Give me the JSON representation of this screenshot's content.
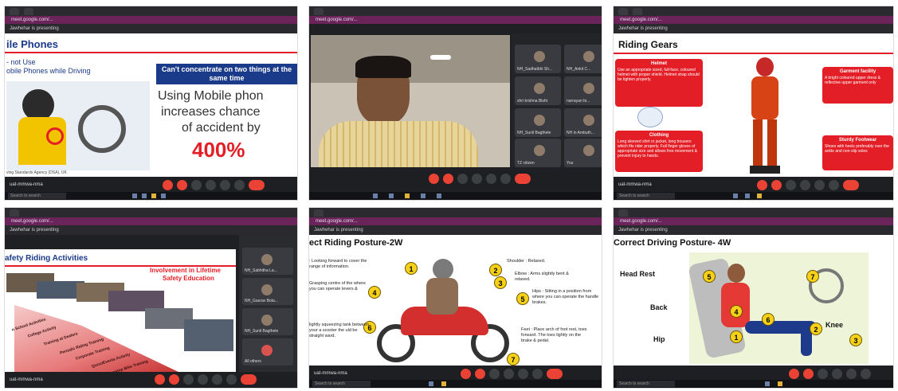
{
  "colors": {
    "meet_bar": "#6a2459",
    "accent_red": "#e31e26",
    "blue_banner": "#1a3a8a",
    "yellow_marker": "#f7d117"
  },
  "common": {
    "url": "meet.google.com/...",
    "presenting": "Jawhehar is presenting",
    "meeting_code": "uat-mmwa-nma",
    "taskbar_search": "Search to search"
  },
  "tile1": {
    "title": "ile Phones",
    "left_text_1": "- not Use",
    "left_text_2": "obile Phones while Driving",
    "banner": "Can't concentrate on two things at the same time",
    "big_1": "Using Mobile phon",
    "big_2": "increases chance",
    "big_3": "of accident by",
    "pct": "400%",
    "footer": "ving Standards Agency (DSA), UK"
  },
  "tile2": {
    "participants": [
      "NH_Sadhatbhi Sh...",
      "NH_Ankit C...",
      "shri krishna Bisht",
      "narrayan bi...",
      "NH_Sunil Bagthele",
      "NH in Ambuth...",
      "TZ citizen",
      "You"
    ]
  },
  "tile3": {
    "title": "Riding Gears",
    "helmet_title": "Helmet",
    "helmet_text": "Use an appropriate sized, full-face, coloured helmet with proper shield. Helmet strap should be tighten properly.",
    "clothing_title": "Clothing",
    "clothing_text": "Long sleeved shirt or jacket, long trousers which fits rider properly. Full finger gloves of appropriate size and allows free movement & prevent injury to hands.",
    "garment_title": "Garment facility",
    "garment_text": "A bright coloured upper dress & reflective upper garment only",
    "footwear_title": "Sturdy Footwear",
    "footwear_text": "Shoes with heels preferably over the ankle and non-slip soles"
  },
  "tile4": {
    "title": "afety Riding Activities",
    "tagline_1": "Involvement in Lifetime",
    "tagline_2": "Safety Education",
    "steps": [
      "n School Activities",
      "College Activity",
      "Training at Dealers",
      "Periodic Riding Training",
      "Corporate Training",
      "Quizz/Events Activity",
      "Hopstop Bike Training"
    ],
    "participants": [
      "NH_Sabhitha La...",
      "NH_Gaurav Bola...",
      "NH_Sunil Bagthele",
      "All others"
    ]
  },
  "tile5": {
    "title": "ect Riding Posture-2W",
    "notes": [
      {
        "n": "1",
        "text": ": Looking forward to cover the range of information."
      },
      {
        "n": "2",
        "text": "Shoulder : Relaxed."
      },
      {
        "n": "3",
        "text": "Elbow : Arms slightly bent & relaxed."
      },
      {
        "n": "4",
        "text": "Grasping centre of the where you can operate levers &"
      },
      {
        "n": "5",
        "text": "Hips : Sitting in a position from where you can operate the handle brakes."
      },
      {
        "n": "6",
        "text": "lightly squeezing tank between your a scooter the uld be straight ward."
      },
      {
        "n": "7",
        "text": "Feet : Place arch of foot rest, toes forward. The toes lightly on the brake & pedal."
      }
    ]
  },
  "tile6": {
    "title": "Correct Driving Posture- 4W",
    "labels": {
      "head_rest": "Head Rest",
      "back": "Back",
      "hip": "Hip",
      "knee": "Knee"
    },
    "markers": [
      "1",
      "2",
      "3",
      "4",
      "5",
      "6",
      "7"
    ]
  }
}
